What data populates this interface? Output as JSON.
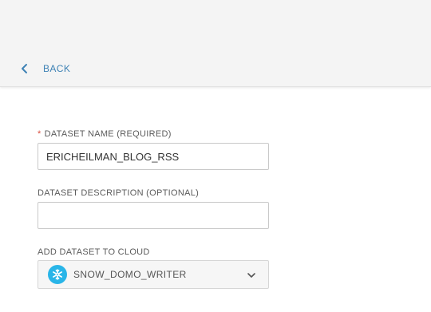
{
  "header": {
    "back_label": "BACK"
  },
  "form": {
    "dataset_name": {
      "required_mark": "*",
      "label": "DATASET NAME (REQUIRED)",
      "value": "ERICHEILMAN_BLOG_RSS"
    },
    "dataset_description": {
      "label": "DATASET DESCRIPTION (OPTIONAL)",
      "value": ""
    },
    "cloud": {
      "label": "ADD DATASET TO CLOUD",
      "selected": "SNOW_DOMO_WRITER",
      "icon": "snowflake-icon"
    }
  },
  "colors": {
    "accent": "#3e82b5",
    "required": "#d94c3d",
    "snowflake": "#29b5e8"
  }
}
